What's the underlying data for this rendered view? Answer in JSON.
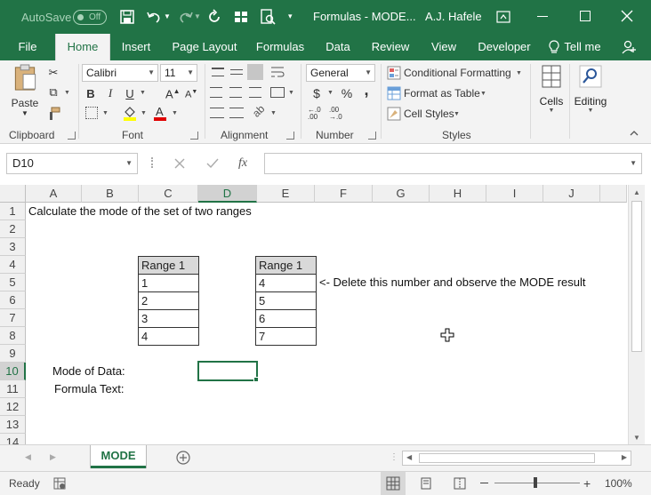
{
  "titlebar": {
    "autosave_label": "AutoSave",
    "autosave_state": "Off",
    "title": "Formulas - MODE...",
    "user": "A.J. Hafele"
  },
  "tabs": [
    {
      "label": "File"
    },
    {
      "label": "Home"
    },
    {
      "label": "Insert"
    },
    {
      "label": "Page Layout"
    },
    {
      "label": "Formulas"
    },
    {
      "label": "Data"
    },
    {
      "label": "Review"
    },
    {
      "label": "View"
    },
    {
      "label": "Developer"
    },
    {
      "label": "Tell me"
    }
  ],
  "ribbon": {
    "clipboard": {
      "paste": "Paste",
      "label": "Clipboard"
    },
    "font": {
      "name": "Calibri",
      "size": "11",
      "label": "Font",
      "bold": "B",
      "italic": "I",
      "underline": "U"
    },
    "alignment": {
      "label": "Alignment"
    },
    "number": {
      "format": "General",
      "label": "Number",
      "currency": "$",
      "percent": "%",
      "comma": ","
    },
    "styles": {
      "conditional": "Conditional Formatting",
      "table": "Format as Table",
      "cell_styles": "Cell Styles",
      "label": "Styles"
    },
    "cells": {
      "label": "Cells"
    },
    "editing": {
      "label": "Editing"
    }
  },
  "formula_bar": {
    "name_box": "D10",
    "fx": "fx",
    "value": ""
  },
  "grid": {
    "columns": [
      "A",
      "B",
      "C",
      "D",
      "E",
      "F",
      "G",
      "H",
      "I",
      "J"
    ],
    "rows": [
      "1",
      "2",
      "3",
      "4",
      "5",
      "6",
      "7",
      "8",
      "9",
      "10",
      "11",
      "12",
      "13",
      "14"
    ],
    "a1": "Calculate the mode of the set of two ranges",
    "note_f5": "<- Delete this number and observe the MODE result",
    "mode_label": "Mode of Data:",
    "formula_label": "Formula Text:",
    "range1": {
      "header": "Range 1",
      "values": [
        "1",
        "2",
        "3",
        "4"
      ]
    },
    "range2": {
      "header": "Range 1",
      "values": [
        "4",
        "5",
        "6",
        "7"
      ]
    }
  },
  "sheet_tabs": [
    {
      "label": "MODE"
    }
  ],
  "status": {
    "ready": "Ready",
    "zoom": "100%"
  },
  "colors": {
    "accent": "#217346"
  }
}
